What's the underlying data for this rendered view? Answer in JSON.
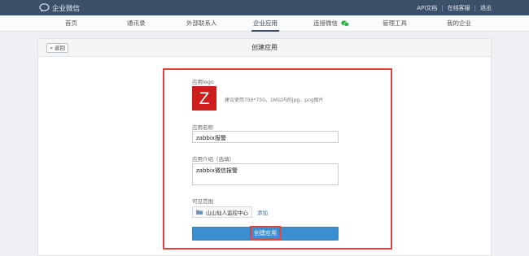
{
  "topbar": {
    "brand": "企业微信",
    "links": [
      "API文档",
      "在线客服",
      "退出"
    ],
    "bg_color": "#3b5069"
  },
  "nav": {
    "items": [
      {
        "label": "首页"
      },
      {
        "label": "通讯录"
      },
      {
        "label": "外部联系人"
      },
      {
        "label": "企业应用",
        "active": true
      },
      {
        "label": "连接微信",
        "badge_icon": "wechat-icon"
      },
      {
        "label": "管理工具"
      },
      {
        "label": "我的企业"
      }
    ]
  },
  "panel": {
    "back_label": "« 返回",
    "title": "创建应用"
  },
  "form": {
    "logo_label": "应用logo",
    "logo_letter": "Z",
    "logo_color": "#cf1c1c",
    "logo_hint": "建议使用750*750，1M以内的jpg、png图片",
    "name_label": "应用名称",
    "name_value": "zabbix报警",
    "desc_label": "应用介绍（选填）",
    "desc_value": "zabbix微信报警",
    "scope_label": "可见范围",
    "scope_item": "山山仙人监控中心",
    "scope_add": "添加",
    "submit_label": "创建应用",
    "highlight_color": "#e5423a"
  }
}
